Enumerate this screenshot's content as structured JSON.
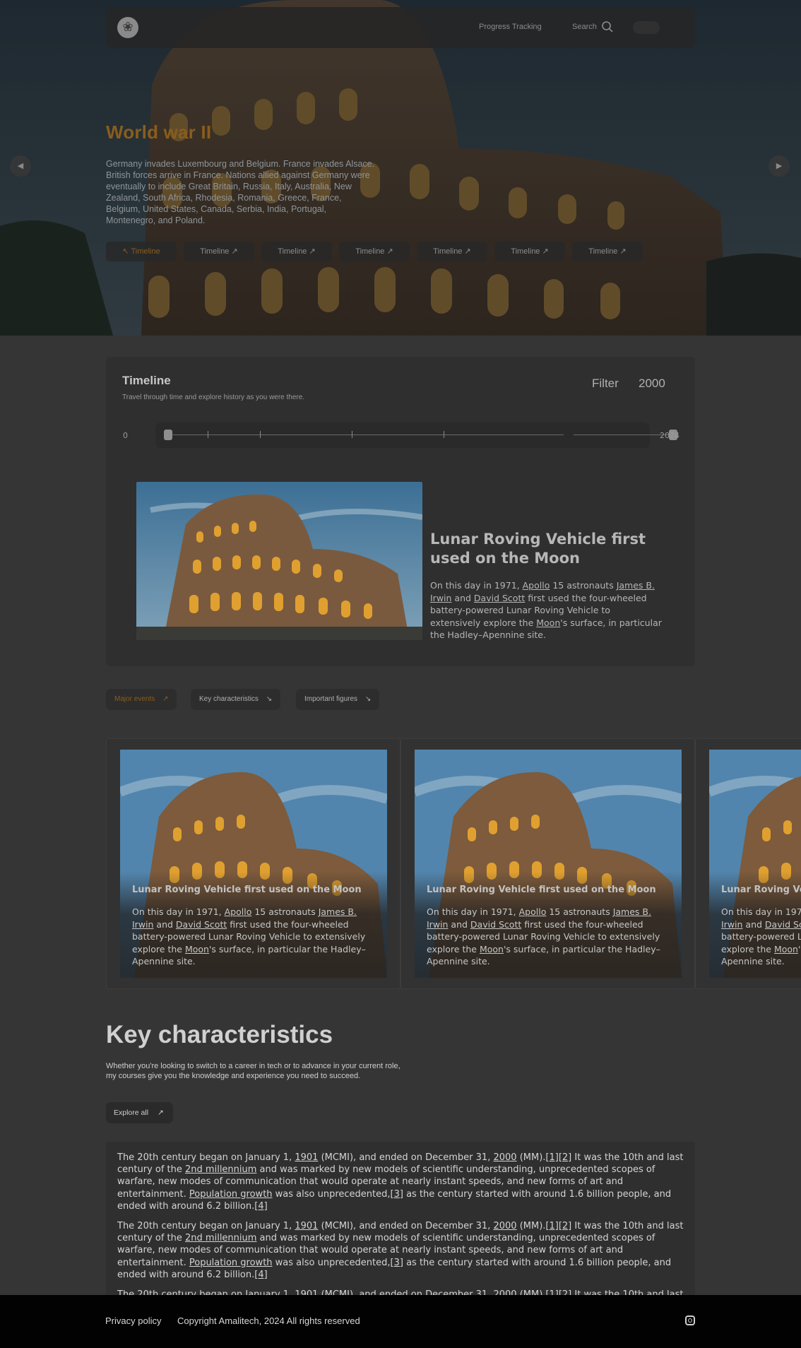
{
  "nav": {
    "logo_glyph": "❀",
    "progress_label": "Progress Tracking",
    "search_label": "Search"
  },
  "hero": {
    "title": "World war II",
    "description": "Germany invades Luxembourg and Belgium. France invades Alsace. British forces arrive in France. Nations allied against Germany were eventually to include Great Britain, Russia, Italy, Australia, New Zealand, South Africa, Rhodesia, Romania, Greece, France, Belgium, United States, Canada, Serbia, India, Portugal, Montenegro, and Poland.",
    "tabs": [
      "Timeline",
      "Timeline",
      "Timeline",
      "Timeline",
      "Timeline",
      "Timeline",
      "Timeline"
    ],
    "active_tab": 0,
    "prev_arrow": "◀",
    "next_arrow": "▶"
  },
  "timeline": {
    "title": "Timeline",
    "subtitle": "Travel through time and explore history as you were there.",
    "filter_label": "Filter",
    "filter_year": "2000",
    "slider_min": "0",
    "slider_max": "2024",
    "feature": {
      "title": "Lunar Roving Vehicle first used on the Moon",
      "text_parts": {
        "p1": "On this day in 1971, ",
        "l1": "Apollo",
        "p2": " 15 astronauts ",
        "l2": "James B. Irwin",
        "p3": " and ",
        "l3": "David Scott",
        "p4": " first used the four-wheeled battery-powered Lunar Roving Vehicle to extensively explore the ",
        "l4": "Moon",
        "p5": "'s surface, in particular the Hadley–Apennine site."
      }
    }
  },
  "categories": [
    "Major events",
    "Key characteristics",
    "Important figures"
  ],
  "cards": [
    {
      "title": "Lunar Roving Vehicle first used on the Moon"
    },
    {
      "title": "Lunar Roving Vehicle first used on the Moon"
    },
    {
      "title": "Lunar Roving Vehicle first used on the Moon"
    }
  ],
  "key_characteristics": {
    "title": "Key characteristics",
    "description": "Whether you're looking to switch to a career in tech or to advance in your current role, my courses give you the knowledge and experience you need to succeed.",
    "explore_label": "Explore all",
    "paragraph": {
      "p1": "The 20th century began on January 1, ",
      "l1": "1901",
      "p2": " (MCMI), and ended on December 31, ",
      "l2": "2000",
      "p3": " (MM).",
      "l3": "[1][2]",
      "p4": " It was the 10th and last century of the ",
      "l4": "2nd millennium",
      "p5": " and was marked by new models of scientific understanding, unprecedented scopes of warfare, new modes of communication that would operate at nearly instant speeds, and new forms of art and entertainment. ",
      "l5": "Population growth",
      "p6": " was also unprecedented,",
      "l6": "[3]",
      "p7": " as the century started with around 1.6 billion people, and ended with around 6.2 billion.",
      "l7": "[4]"
    }
  },
  "footer": {
    "privacy": "Privacy policy",
    "copyright": "Copyright Amalitech, 2024 All rights reserved"
  },
  "colors": {
    "accent": "#8a5d1c",
    "background": "#353535",
    "panel": "#2f2f2f",
    "footer": "#020202"
  }
}
